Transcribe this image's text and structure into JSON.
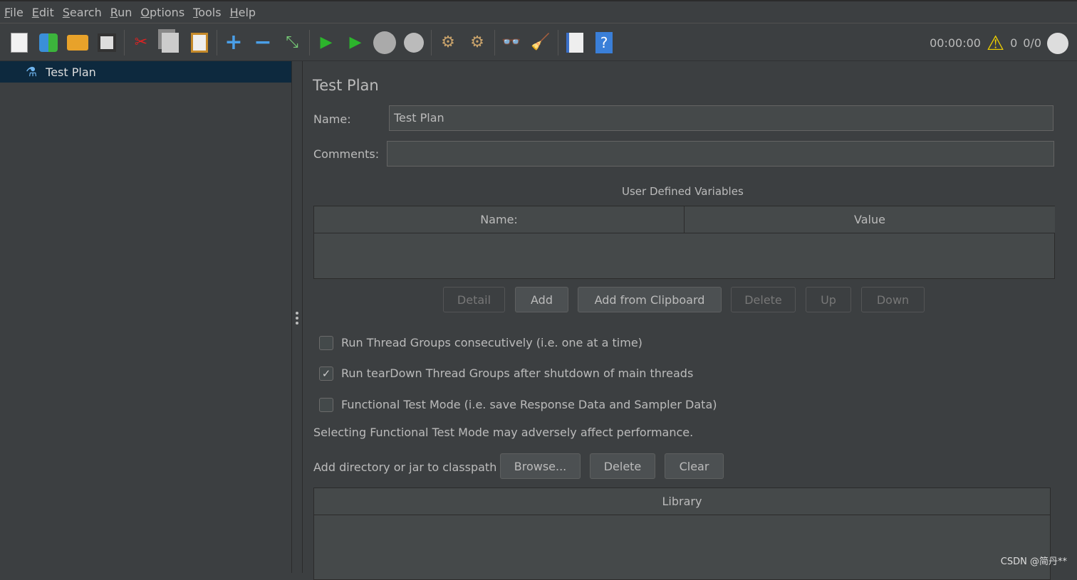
{
  "menubar": {
    "items": [
      {
        "label": "File",
        "mnemonic": "F",
        "rest": "ile"
      },
      {
        "label": "Edit",
        "mnemonic": "E",
        "rest": "dit"
      },
      {
        "label": "Search",
        "mnemonic": "S",
        "rest": "earch"
      },
      {
        "label": "Run",
        "mnemonic": "R",
        "rest": "un"
      },
      {
        "label": "Options",
        "mnemonic": "O",
        "rest": "ptions"
      },
      {
        "label": "Tools",
        "mnemonic": "T",
        "rest": "ools"
      },
      {
        "label": "Help",
        "mnemonic": "H",
        "rest": "elp"
      }
    ]
  },
  "toolbar": {
    "icons": [
      "new-icon",
      "templates-icon",
      "open-icon",
      "save-icon",
      "cut-icon",
      "copy-icon",
      "paste-icon",
      "expand-icon",
      "collapse-icon",
      "toggle-icon",
      "start-icon",
      "start-no-pauses-icon",
      "stop-icon",
      "shutdown-icon",
      "clear-icon",
      "clear-all-icon",
      "search-icon",
      "reset-search-icon",
      "function-helper-icon",
      "help-icon"
    ]
  },
  "status": {
    "timer": "00:00:00",
    "warnings": "0",
    "threads": "0/0"
  },
  "tree": {
    "selected": "Test Plan"
  },
  "main": {
    "title": "Test Plan",
    "name_label": "Name:",
    "name_value": "Test Plan",
    "comments_label": "Comments:",
    "comments_value": "",
    "udv_title": "User Defined Variables",
    "udv_columns": [
      "Name:",
      "Value"
    ],
    "buttons": {
      "detail": "Detail",
      "add": "Add",
      "add_clipboard": "Add from Clipboard",
      "delete": "Delete",
      "up": "Up",
      "down": "Down"
    },
    "checkboxes": [
      {
        "label": "Run Thread Groups consecutively (i.e. one at a time)",
        "checked": false
      },
      {
        "label": "Run tearDown Thread Groups after shutdown of main threads",
        "checked": true
      },
      {
        "label": "Functional Test Mode (i.e. save Response Data and Sampler Data)",
        "checked": false
      }
    ],
    "warning_text": "Selecting Functional Test Mode may adversely affect performance.",
    "classpath_label": "Add directory or jar to classpath",
    "classpath_buttons": {
      "browse": "Browse...",
      "delete": "Delete",
      "clear": "Clear"
    },
    "library_column": "Library"
  },
  "watermark": "CSDN @简丹**"
}
